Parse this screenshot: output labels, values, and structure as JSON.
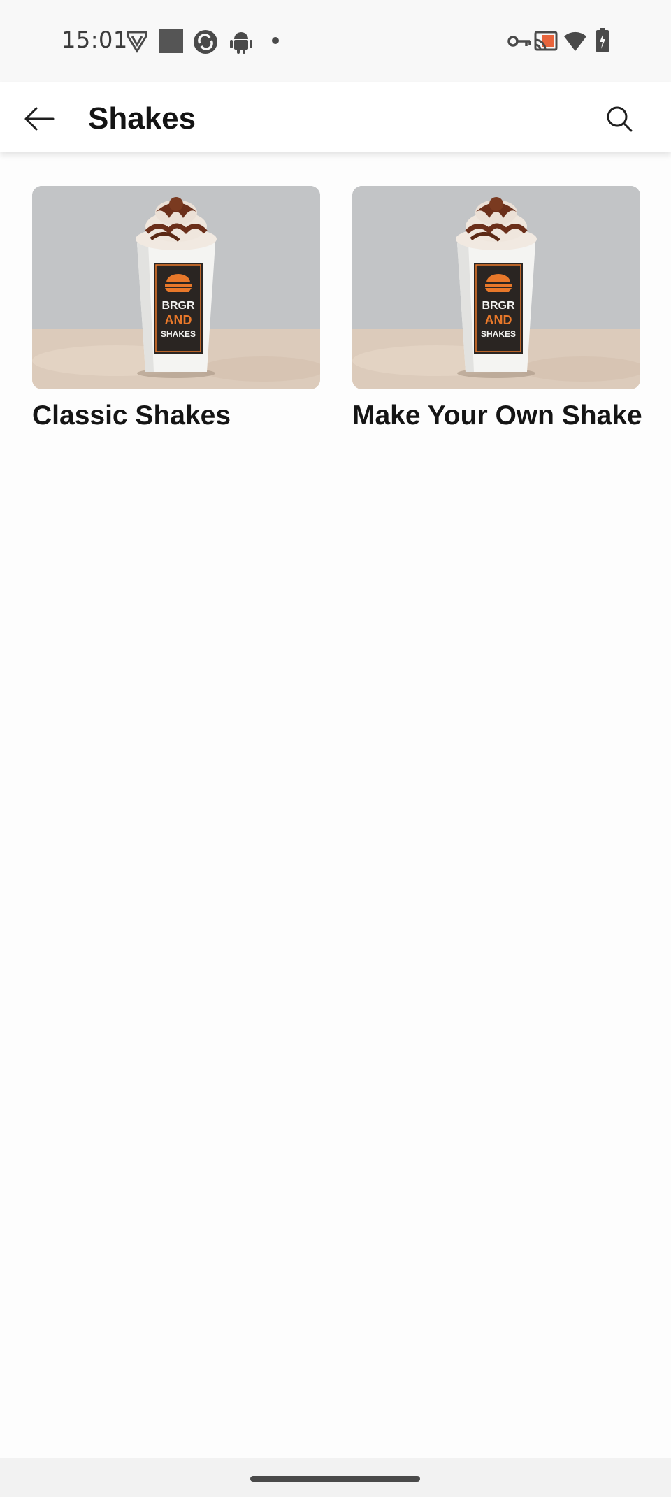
{
  "status_bar": {
    "time": "15:01",
    "icons": [
      "shield-v-icon",
      "square-app-icon",
      "sync-circle-icon",
      "android-icon",
      "dot-icon",
      "key-icon",
      "cast-icon",
      "wifi-icon",
      "battery-charging-icon"
    ]
  },
  "app_bar": {
    "title": "Shakes",
    "back_icon": "arrow-left-icon",
    "search_icon": "search-icon"
  },
  "products": [
    {
      "name": "Classic Shakes",
      "image": "milkshake-cup-photo"
    },
    {
      "name": "Make Your Own Shake",
      "image": "milkshake-cup-photo"
    }
  ],
  "cup_logo": {
    "line1": "BRGR",
    "line2": "AND",
    "line3": "SHAKES"
  },
  "colors": {
    "accent_orange": "#e8782a",
    "text_dark": "#141414"
  }
}
